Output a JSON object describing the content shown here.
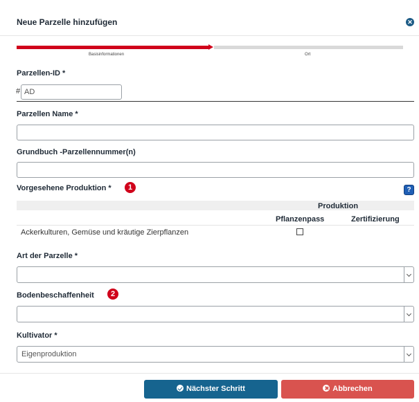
{
  "dialog": {
    "title": "Neue Parzelle hinzufügen",
    "close_icon": "close-circle-icon"
  },
  "stepper": {
    "steps": [
      {
        "label": "Basisinformationen",
        "active": true
      },
      {
        "label": "Ort",
        "active": false
      }
    ],
    "active_color": "#d0021b",
    "inactive_color": "#d9d9d9"
  },
  "fields": {
    "parcel_id": {
      "label": "Parzellen-ID *",
      "prefix": "#",
      "value": "AD"
    },
    "parcel_name": {
      "label": "Parzellen Name *",
      "value": ""
    },
    "land_register": {
      "label": "Grundbuch -Parzellennummer(n)",
      "value": ""
    },
    "production": {
      "label": "Vorgesehene Produktion *",
      "badge": "1",
      "help_icon": "question-icon",
      "group_header": "Produktion",
      "columns": [
        "Pflanzenpass",
        "Zertifizierung"
      ],
      "rows": [
        {
          "name": "Ackerkulturen, Gemüse und kräutige Zierpflanzen",
          "pflanzenpass": false
        }
      ]
    },
    "parcel_type": {
      "label": "Art der Parzelle *",
      "value": ""
    },
    "soil": {
      "label": "Bodenbeschaffenheit",
      "badge": "2",
      "value": ""
    },
    "cultivator": {
      "label": "Kultivator *",
      "value": "Eigenproduktion"
    }
  },
  "footer": {
    "next_label": "Nächster Schritt",
    "next_icon": "check-circle-icon",
    "cancel_label": "Abbrechen",
    "cancel_icon": "times-circle-icon",
    "next_color": "#16648f",
    "cancel_color": "#d9534f"
  }
}
